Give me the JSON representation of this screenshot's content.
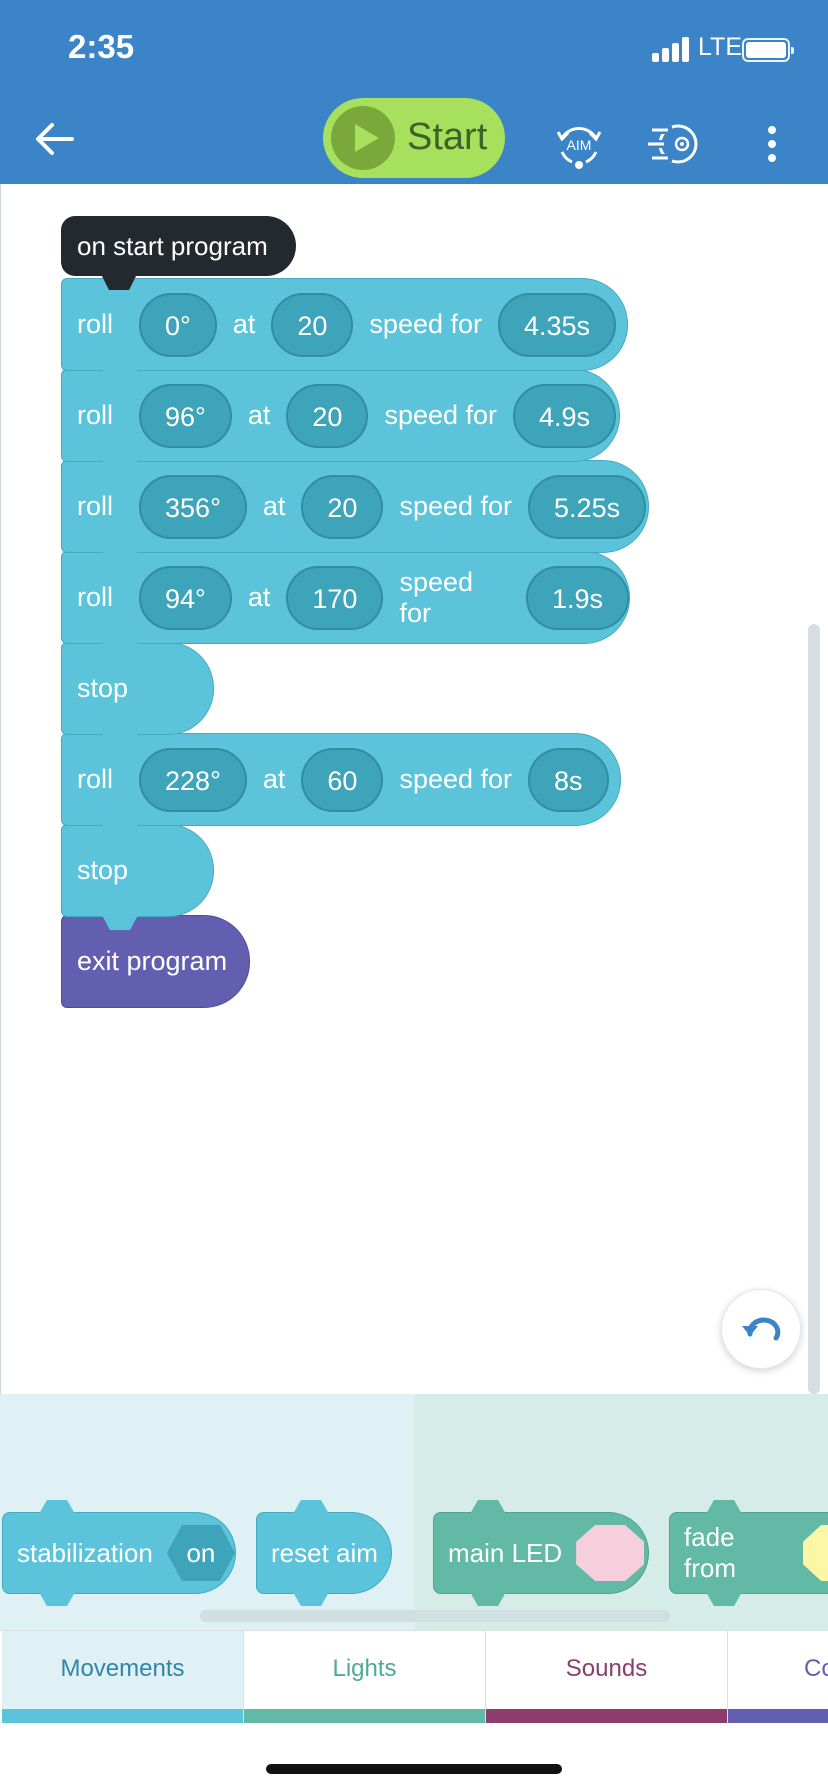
{
  "status_bar": {
    "time": "2:35",
    "network": "LTE"
  },
  "toolbar": {
    "start_label": "Start",
    "aim_label": "AIM"
  },
  "program": {
    "hat_label": "on start program",
    "blocks": [
      {
        "kw": "roll",
        "heading": "0°",
        "at": "at",
        "speed": "20",
        "speed_for": "speed for",
        "duration": "4.35s"
      },
      {
        "kw": "roll",
        "heading": "96°",
        "at": "at",
        "speed": "20",
        "speed_for": "speed for",
        "duration": "4.9s"
      },
      {
        "kw": "roll",
        "heading": "356°",
        "at": "at",
        "speed": "20",
        "speed_for": "speed for",
        "duration": "5.25s"
      },
      {
        "kw": "roll",
        "heading": "94°",
        "at": "at",
        "speed": "170",
        "speed_for": "speed for",
        "duration": "1.9s"
      },
      {
        "kw": "stop"
      },
      {
        "kw": "roll",
        "heading": "228°",
        "at": "at",
        "speed": "60",
        "speed_for": "speed for",
        "duration": "8s"
      },
      {
        "kw": "stop"
      },
      {
        "kw": "exit program"
      }
    ]
  },
  "palette": {
    "stabilization_label": "stabilization",
    "stabilization_value": "on",
    "reset_aim_label": "reset aim",
    "main_led_label": "main LED",
    "fade_from_label": "fade from"
  },
  "tabs": {
    "movements": "Movements",
    "lights": "Lights",
    "sounds": "Sounds",
    "controls": "Co"
  },
  "colors": {
    "header": "#3a84c7",
    "start_button": "#a7e05c",
    "movement_block": "#5bc4db",
    "exit_block": "#625fb0",
    "lights_block": "#62b9a6",
    "sounds_tab": "#8b3d6c"
  }
}
